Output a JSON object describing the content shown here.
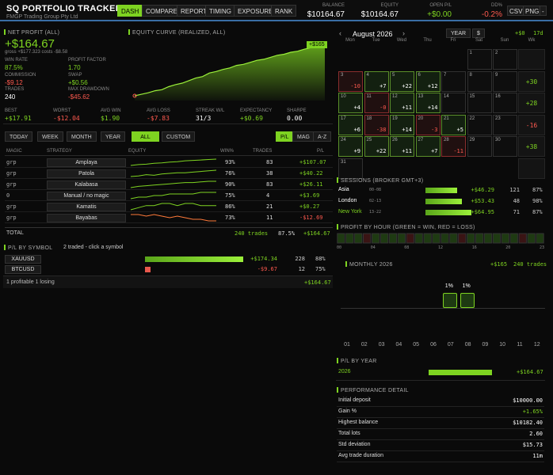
{
  "app": {
    "title": "SQ  PORTFOLIO TRACKER",
    "subtitle": "FMGP Trading Group Pty Ltd"
  },
  "nav": {
    "tabs": [
      {
        "label": "DASH",
        "active": true
      },
      {
        "label": "COMPARE"
      },
      {
        "label": "REPORT"
      },
      {
        "label": "TIMING"
      },
      {
        "label": "EXPOSURE"
      },
      {
        "label": "RANK"
      }
    ]
  },
  "header_stats": {
    "balance_label": "BALANCE",
    "balance": "$10164.67",
    "equity_label": "EQUITY",
    "equity": "$10164.67",
    "open_label": "OPEN P/L",
    "open": "+$0.00",
    "dd_label": "DD%",
    "dd": "-0.2%",
    "csv": "CSV",
    "png": "PNG",
    "more": "-"
  },
  "net": {
    "label": "NET PROFIT (ALL)",
    "value": "+$164.67",
    "gross": "gross +$177.323  costs -$8.58",
    "win_rate_l": "WIN RATE",
    "win_rate": "87.5%",
    "pf_l": "PROFIT FACTOR",
    "pf": "1.70",
    "comm_l": "COMMISSION",
    "comm": "-$9.12",
    "swap_l": "SWAP",
    "swap": "+$0.56",
    "trades_l": "TRADES",
    "trades": "240",
    "maxdd_l": "MAX DRAWDOWN",
    "maxdd": "-$45.62"
  },
  "equity": {
    "label": "EQUITY CURVE  (realized, ALL)",
    "badge": "+$165",
    "values": [
      0,
      3,
      6,
      10,
      12,
      18,
      22,
      25,
      30,
      35,
      38,
      45,
      48,
      52,
      55,
      60,
      62,
      66,
      70,
      72,
      76,
      80,
      82,
      86,
      88,
      92,
      95,
      98,
      100
    ]
  },
  "kpis": [
    {
      "l": "BEST",
      "v": "+$17.91",
      "c": "g"
    },
    {
      "l": "WORST",
      "v": "-$12.04",
      "c": "r"
    },
    {
      "l": "AVG WIN",
      "v": "$1.90",
      "c": "g"
    },
    {
      "l": "AVG LOSS",
      "v": "-$7.83",
      "c": "r"
    },
    {
      "l": "STREAK W/L",
      "v": "31/3",
      "c": "w"
    },
    {
      "l": "EXPECTANCY",
      "v": "+$0.69",
      "c": "g"
    },
    {
      "l": "SHARPE",
      "v": "0.00",
      "c": "w"
    }
  ],
  "periods": [
    "TODAY",
    "WEEK",
    "MONTH",
    "YEAR",
    "ALL",
    "CUSTOM"
  ],
  "groupby": [
    "P/L",
    "MAG",
    "A-Z"
  ],
  "magic_table": {
    "headers": [
      "MAGIC",
      "STRATEGY",
      "EQUITY",
      "WIN%",
      "TRADES",
      "P/L"
    ],
    "rows": [
      {
        "magic": "grp",
        "strategy": "Amplaya",
        "win": "93%",
        "trades": "83",
        "pl": "+$107.07",
        "c": "g",
        "spark": [
          0,
          2,
          3,
          5,
          6,
          8,
          9,
          11,
          12,
          13,
          14,
          15
        ]
      },
      {
        "magic": "grp",
        "strategy": "Patola",
        "win": "76%",
        "trades": "38",
        "pl": "+$40.22",
        "c": "g",
        "spark": [
          0,
          1,
          3,
          2,
          4,
          5,
          6,
          6,
          7,
          8,
          9,
          10
        ]
      },
      {
        "magic": "grp",
        "strategy": "Kalabasa",
        "win": "90%",
        "trades": "83",
        "pl": "+$26.11",
        "c": "g",
        "spark": [
          0,
          2,
          3,
          4,
          5,
          6,
          7,
          8,
          8,
          9,
          10,
          10
        ]
      },
      {
        "magic": "0",
        "strategy": "Manual / no magic",
        "win": "75%",
        "trades": "4",
        "pl": "+$3.69",
        "c": "g",
        "spark": [
          0,
          1,
          1,
          2,
          2,
          3,
          3,
          3,
          3,
          4,
          4,
          4
        ]
      },
      {
        "magic": "grp",
        "strategy": "Kamatis",
        "win": "86%",
        "trades": "21",
        "pl": "+$0.27",
        "c": "g",
        "spark": [
          0,
          1,
          2,
          2,
          3,
          3,
          2,
          3,
          3,
          2,
          2,
          2
        ]
      },
      {
        "magic": "grp",
        "strategy": "Bayabas",
        "win": "73%",
        "trades": "11",
        "pl": "-$12.69",
        "c": "r",
        "spark": [
          4,
          4,
          3,
          4,
          3,
          2,
          3,
          2,
          1,
          1,
          0,
          0
        ]
      }
    ],
    "total": {
      "label": "TOTAL",
      "trades": "240 trades",
      "win": "87.5%",
      "pl": "+$164.67"
    }
  },
  "symbols": {
    "label": "P/L BY SYMBOL",
    "info": "2 traded  -  click a symbol",
    "rows": [
      {
        "sym": "XAUUSD",
        "pl": "+$174.34",
        "trades": "228",
        "win": "88%",
        "frac": 1.0,
        "c": "g"
      },
      {
        "sym": "BTCUSD",
        "pl": "-$9.67",
        "trades": "12",
        "win": "75%",
        "frac": 0.055,
        "c": "r"
      }
    ],
    "footer": "1 profitable  1 losing",
    "footer_val": "+$164.67"
  },
  "calendar": {
    "month": "August 2026",
    "year_btn": "YEAR",
    "cur_btn": "$",
    "summary": "+$0",
    "summary2": "17d",
    "dow": [
      "Mon",
      "Tue",
      "Wed",
      "Thu",
      "Fri",
      "Sat",
      "Sun",
      "Wk"
    ],
    "weeks": [
      [
        {
          "d": ""
        },
        {
          "d": ""
        },
        {
          "d": ""
        },
        {
          "d": ""
        },
        {
          "d": ""
        },
        {
          "d": "1"
        },
        {
          "d": "2"
        }
      ],
      [
        {
          "d": "3",
          "v": "-10",
          "c": "rd"
        },
        {
          "d": "4",
          "v": "+7",
          "c": "gr"
        },
        {
          "d": "5",
          "v": "+22",
          "c": "gr"
        },
        {
          "d": "6",
          "v": "+12",
          "c": "gr"
        },
        {
          "d": "7"
        },
        {
          "d": "8"
        },
        {
          "d": "9"
        }
      ],
      [
        {
          "d": "10",
          "v": "+4",
          "c": "gr"
        },
        {
          "d": "11",
          "v": "-0",
          "c": "rd"
        },
        {
          "d": "12",
          "v": "+11",
          "c": "gr"
        },
        {
          "d": "13",
          "v": "+14",
          "c": "gr"
        },
        {
          "d": "14"
        },
        {
          "d": "15"
        },
        {
          "d": "16"
        }
      ],
      [
        {
          "d": "17",
          "v": "+6",
          "c": "gr"
        },
        {
          "d": "18",
          "v": "-38",
          "c": "rd"
        },
        {
          "d": "19",
          "v": "+14",
          "c": "gr"
        },
        {
          "d": "20",
          "v": "-3",
          "c": "rd"
        },
        {
          "d": "21",
          "v": "+5",
          "c": "gr"
        },
        {
          "d": "22"
        },
        {
          "d": "23"
        }
      ],
      [
        {
          "d": "24",
          "v": "+9",
          "c": "gr"
        },
        {
          "d": "25",
          "v": "+22",
          "c": "gr"
        },
        {
          "d": "26",
          "v": "+11",
          "c": "gr"
        },
        {
          "d": "27",
          "v": "+7",
          "c": "gr"
        },
        {
          "d": "28",
          "v": "-11",
          "c": "rd"
        },
        {
          "d": "29"
        },
        {
          "d": "30"
        }
      ],
      [
        {
          "d": "31"
        }
      ]
    ],
    "weektotals": [
      {
        "v": "",
        "c": ""
      },
      {
        "v": "+30",
        "c": "g"
      },
      {
        "v": "+28",
        "c": "g"
      },
      {
        "v": "-16",
        "c": "r"
      },
      {
        "v": "+38",
        "c": "g"
      },
      {
        "v": "",
        "c": ""
      }
    ]
  },
  "sessions": {
    "label": "SESSIONS  (broker GMT+3)",
    "rows": [
      {
        "name": "Asia",
        "time": "00-08",
        "pl": "+$46.29",
        "trades": "121",
        "win": "87%",
        "frac": 0.5,
        "nc": "w"
      },
      {
        "name": "London",
        "time": "02-13",
        "pl": "+$53.43",
        "trades": "48",
        "win": "98%",
        "frac": 0.58,
        "nc": "w"
      },
      {
        "name": "New York",
        "time": "13-22",
        "pl": "+$64.95",
        "trades": "71",
        "win": "87%",
        "frac": 0.72,
        "nc": "g"
      }
    ]
  },
  "hourly": {
    "label": "PROFIT BY HOUR  (green = win, red = loss)",
    "ticks": [
      "00",
      "04",
      "08",
      "12",
      "16",
      "20",
      "23"
    ],
    "values": [
      2,
      1,
      3,
      -1,
      2,
      3,
      2,
      1,
      -2,
      3,
      2,
      1,
      3,
      2,
      -1,
      2,
      3,
      2,
      1,
      2,
      3,
      -1,
      2,
      1
    ]
  },
  "monthly": {
    "label": "MONTHLY  2026",
    "total": "+$165",
    "trades": "240 trades",
    "months": [
      "01",
      "02",
      "03",
      "04",
      "05",
      "06",
      "07",
      "08",
      "09",
      "10",
      "11",
      "12"
    ],
    "values": [
      0,
      0,
      0,
      0,
      0,
      0,
      1,
      1,
      0,
      0,
      0,
      0
    ],
    "bar_labels": {
      "07": "1%",
      "08": "1%"
    }
  },
  "yearly": {
    "label": "P/L BY YEAR",
    "rows": [
      {
        "year": "2026",
        "pl": "+$164.67",
        "frac": 0.75
      }
    ]
  },
  "performance": {
    "label": "PERFORMANCE DETAIL",
    "rows": [
      {
        "k": "Initial deposit",
        "v": "$10000.00",
        "c": "w"
      },
      {
        "k": "Gain %",
        "v": "+1.65%",
        "c": "g"
      },
      {
        "k": "Highest balance",
        "v": "$10182.40",
        "c": "w"
      },
      {
        "k": "Total lots",
        "v": "2.60",
        "c": "w"
      },
      {
        "k": "Std deviation",
        "v": "$15.73",
        "c": "w"
      },
      {
        "k": "Avg trade duration",
        "v": "11m",
        "c": "w"
      }
    ]
  }
}
